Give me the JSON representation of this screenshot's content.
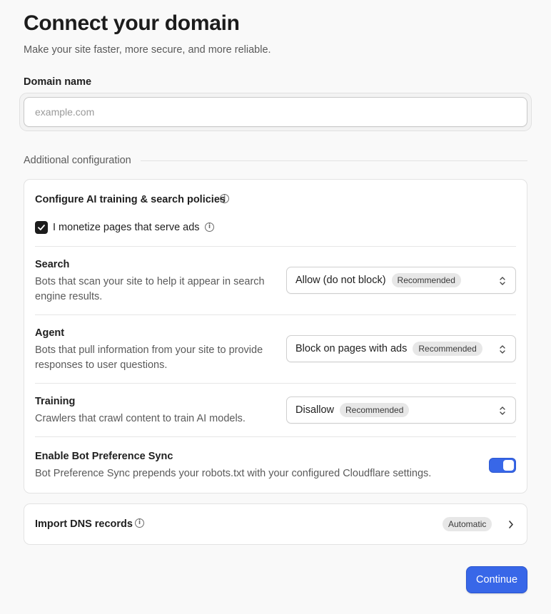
{
  "header": {
    "title": "Connect your domain",
    "subtitle": "Make your site faster, more secure, and more reliable."
  },
  "domain_field": {
    "label": "Domain name",
    "value": "",
    "placeholder": "example.com"
  },
  "additional": {
    "heading": "Additional configuration"
  },
  "ai_policies": {
    "title": "Configure AI training & search policies",
    "info_icon": "info-icon",
    "monetize": {
      "label": "I monetize pages that serve ads",
      "checked": true
    },
    "rows": [
      {
        "title": "Search",
        "description": "Bots that scan your site to help it appear in search engine results.",
        "value": "Allow (do not block)",
        "badge": "Recommended"
      },
      {
        "title": "Agent",
        "description": "Bots that pull information from your site to provide responses to user questions.",
        "value": "Block on pages with ads",
        "badge": "Recommended"
      },
      {
        "title": "Training",
        "description": "Crawlers that crawl content to train AI models.",
        "value": "Disallow",
        "badge": "Recommended"
      }
    ],
    "sync": {
      "title": "Enable Bot Preference Sync",
      "description": "Bot Preference Sync prepends your robots.txt with your configured Cloudflare settings.",
      "enabled": true
    }
  },
  "dns": {
    "title": "Import DNS records",
    "badge": "Automatic"
  },
  "actions": {
    "continue_label": "Continue"
  },
  "colors": {
    "accent": "#3867e8",
    "badge_bg": "#e7e7e7"
  }
}
